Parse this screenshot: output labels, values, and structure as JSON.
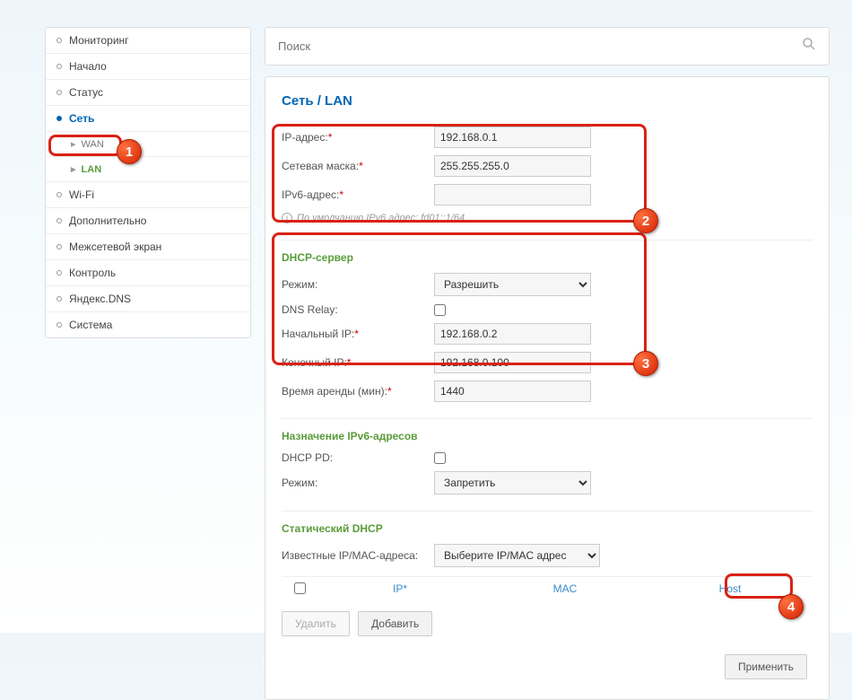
{
  "sidebar": {
    "items": [
      {
        "label": "Мониторинг"
      },
      {
        "label": "Начало"
      },
      {
        "label": "Статус"
      },
      {
        "label": "Сеть"
      },
      {
        "label": "Wi-Fi"
      },
      {
        "label": "Дополнительно"
      },
      {
        "label": "Межсетевой экран"
      },
      {
        "label": "Контроль"
      },
      {
        "label": "Яндекс.DNS"
      },
      {
        "label": "Система"
      }
    ],
    "sub": {
      "wan": "WAN",
      "lan": "LAN"
    }
  },
  "search": {
    "placeholder": "Поиск"
  },
  "breadcrumb": "Сеть /  LAN",
  "basic": {
    "ip_label": "IP-адрес:",
    "ip_value": "192.168.0.1",
    "mask_label": "Сетевая маска:",
    "mask_value": "255.255.255.0",
    "ipv6_label": "IPv6-адрес:",
    "ipv6_value": "",
    "hint": "По умолчанию IPv6 адрес: fd01::1/64"
  },
  "dhcp": {
    "title": "DHCP-сервер",
    "mode_label": "Режим:",
    "mode_value": "Разрешить",
    "dns_label": "DNS Relay:",
    "start_label": "Начальный IP:",
    "start_value": "192.168.0.2",
    "end_label": "Конечный IP:",
    "end_value": "192.168.0.100",
    "lease_label": "Время аренды (мин):",
    "lease_value": "1440"
  },
  "ipv6assign": {
    "title": "Назначение IPv6-адресов",
    "pd_label": "DHCP PD:",
    "mode_label": "Режим:",
    "mode_value": "Запретить"
  },
  "staticdhcp": {
    "title": "Статический DHCP",
    "known_label": "Известные IP/MAC-адреса:",
    "known_value": "Выберите IP/MAC адрес",
    "th_ip": "IP*",
    "th_mac": "MAC",
    "th_host": "Host",
    "btn_delete": "Удалить",
    "btn_add": "Добавить"
  },
  "apply_label": "Применить",
  "badges": {
    "b1": "1",
    "b2": "2",
    "b3": "3",
    "b4": "4"
  }
}
